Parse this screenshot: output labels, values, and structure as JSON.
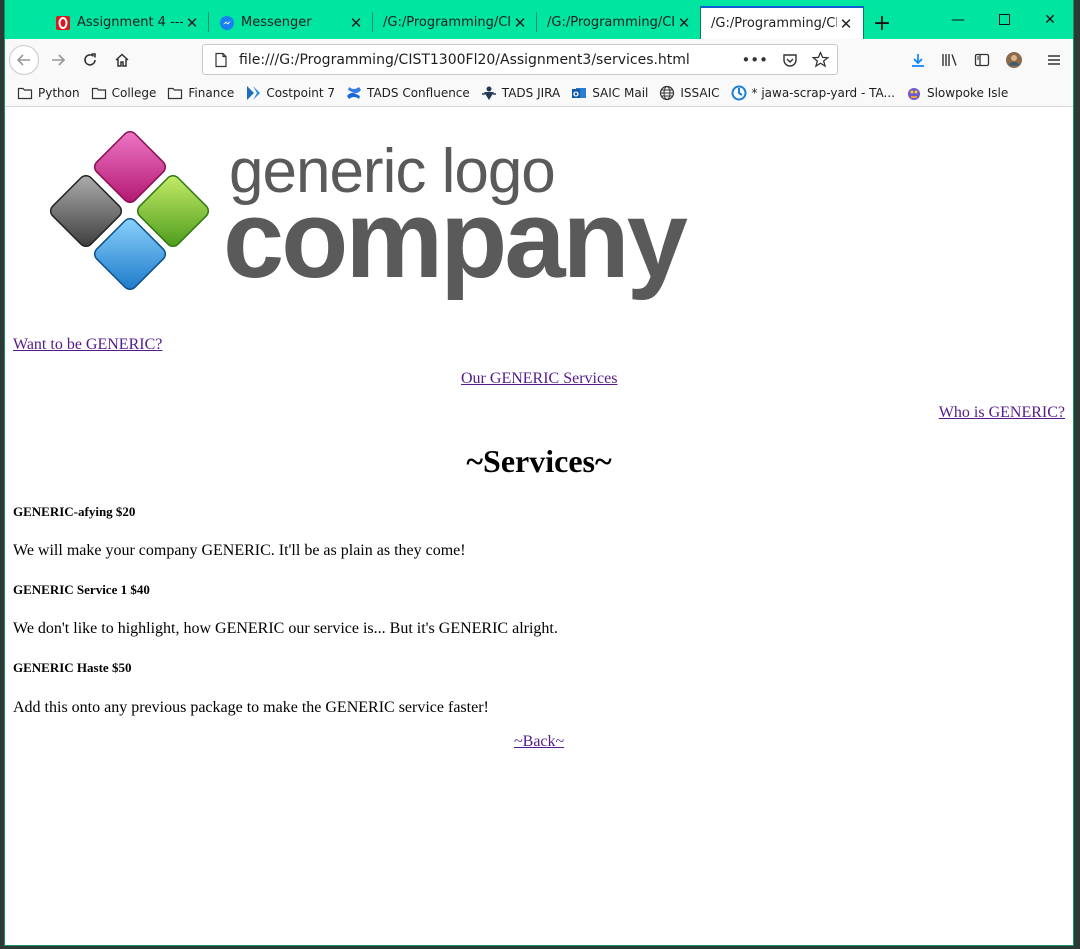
{
  "browser": {
    "tabs": [
      {
        "title": "Assignment 4 --- C",
        "favicon": "unomaha-o-icon"
      },
      {
        "title": "Messenger",
        "favicon": "messenger-icon"
      },
      {
        "title": "/G:/Programming/CIST",
        "favicon": ""
      },
      {
        "title": "/G:/Programming/CIST",
        "favicon": ""
      },
      {
        "title": "/G:/Programming/CIST",
        "favicon": "",
        "active": true
      }
    ],
    "url": "file:///G:/Programming/CIST1300Fl20/Assignment3/services.html",
    "bookmarks": [
      {
        "label": "Python",
        "icon": "folder-icon"
      },
      {
        "label": "College",
        "icon": "folder-icon"
      },
      {
        "label": "Finance",
        "icon": "folder-icon"
      },
      {
        "label": "Costpoint 7",
        "icon": "costpoint-icon"
      },
      {
        "label": "TADS Confluence",
        "icon": "confluence-icon"
      },
      {
        "label": "TADS JIRA",
        "icon": "jira-icon"
      },
      {
        "label": "SAIC Mail",
        "icon": "outlook-icon"
      },
      {
        "label": "ISSAIC",
        "icon": "globe-icon"
      },
      {
        "label": "* jawa-scrap-yard - TA...",
        "icon": "jawa-icon"
      },
      {
        "label": "Slowpoke Isle",
        "icon": "slowpoke-icon"
      }
    ],
    "accent_color": "#00e6a0"
  },
  "page": {
    "logo": {
      "line1": "generic logo",
      "line2": "company"
    },
    "nav": {
      "left": "Want to be GENERIC?",
      "center": "Our GENERIC Services",
      "right": "Who is GENERIC?"
    },
    "heading": "~Services~",
    "services": [
      {
        "title": "GENERIC-afying $20",
        "desc": "We will make your company GENERIC. It'll be as plain as they come!"
      },
      {
        "title": "GENERIC Service 1 $40",
        "desc": "We don't like to highlight, how GENERIC our service is... But it's GENERIC alright."
      },
      {
        "title": "GENERIC Haste $50",
        "desc": "Add this onto any previous package to make the GENERIC service faster!"
      }
    ],
    "back_link": "~Back~",
    "link_color": "#551a8b"
  }
}
